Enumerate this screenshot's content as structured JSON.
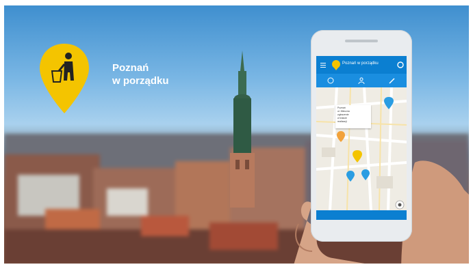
{
  "headline": {
    "line1": "Poznań",
    "line2": "w porządku"
  },
  "app": {
    "title": "Poznań w porządku",
    "popup": [
      "Poznań",
      "ul. Mleczna",
      "zgłoszenie",
      "w trakcie",
      "realizacji"
    ]
  },
  "icons": {
    "logo": "trash-person-icon",
    "menu": "menu-icon",
    "app_logo": "pin-icon",
    "refresh": "refresh-icon",
    "tab1": "clock-icon",
    "tab2": "person-icon",
    "tab3": "edit-icon",
    "locate": "locate-icon"
  },
  "colors": {
    "brand_yellow": "#f4c400",
    "app_blue": "#0b7fd1",
    "pin_blue": "#2a9de2",
    "pin_orange": "#f2a23a"
  }
}
